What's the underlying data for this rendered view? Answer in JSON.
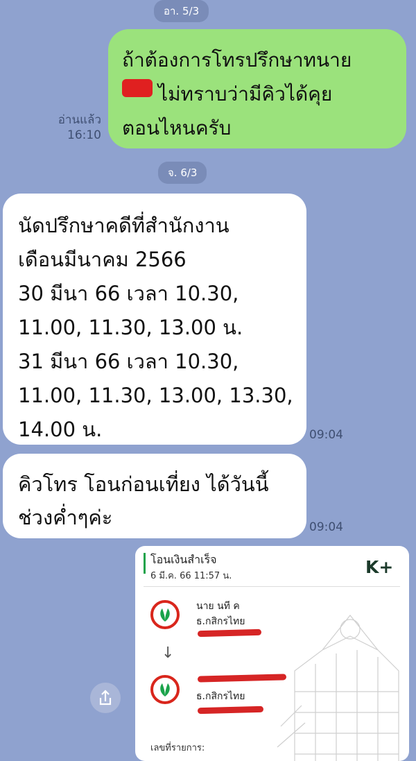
{
  "date_divider_1": "อา. 5/3",
  "date_divider_2": "จ. 6/3",
  "msg_out": {
    "lines": [
      "ถ้าต้องการโทรปรึกษาทนาย",
      "ไม่ทราบว่ามีคิวได้คุย",
      "ตอนไหนครับ"
    ],
    "read_label": "อ่านแล้ว",
    "time": "16:10"
  },
  "msg_in_1": {
    "lines": [
      "นัดปรึกษาคดีที่สำนักงาน",
      "เดือนมีนาคม 2566",
      "30 มีนา 66 เวลา 10.30,",
      "11.00, 11.30, 13.00 น.",
      "31 มีนา 66 เวลา 10.30,",
      "11.00, 11.30, 13.00, 13.30,",
      "14.00 น."
    ],
    "time": "09:04"
  },
  "msg_in_2": {
    "lines": [
      "คิวโทร โอนก่อนเที่ยง ได้วันนี้",
      "ช่วงค่ำๆค่ะ"
    ],
    "time": "09:04"
  },
  "transfer_card": {
    "title": "โอนเงินสำเร็จ",
    "datetime": "6 มี.ค. 66  11:57 น.",
    "brand": "K+",
    "from_name": "นาย นที ค",
    "from_bank": "ธ.กสิกรไทย",
    "to_bank": "ธ.กสิกรไทย",
    "ref_label": "เลขที่รายการ:",
    "arrow": "↓"
  },
  "colors": {
    "background": "#8fa2cf",
    "outgoing_bubble": "#9be27c",
    "incoming_bubble": "#ffffff",
    "kbank_green": "#1aa34a",
    "redaction_red": "#e02020"
  }
}
